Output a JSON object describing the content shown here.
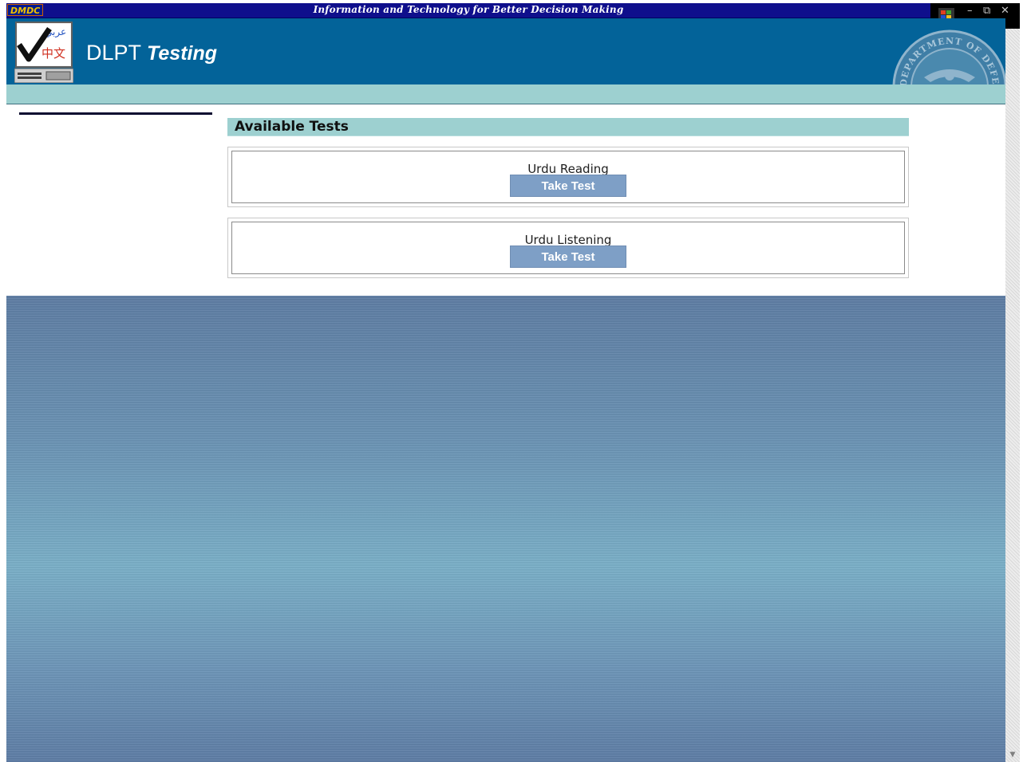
{
  "top_strip": {
    "badge": "DMDC",
    "slogan": "Information and Technology for Better Decision Making",
    "window_controls": {
      "minimize": "–",
      "restore": "⧉",
      "close": "✕"
    }
  },
  "header": {
    "logo_icon": "dlpt-checkmark-logo-icon",
    "title_main": "DLPT",
    "title_sub": "Testing",
    "seal_icon": "department-of-defense-seal-icon",
    "seal_text": "DEPARTMENT OF DEFENSE"
  },
  "main": {
    "section_title": "Available Tests",
    "tests": [
      {
        "name": "Urdu Reading",
        "button_label": "Take Test"
      },
      {
        "name": "Urdu Listening",
        "button_label": "Take Test"
      }
    ]
  },
  "colors": {
    "banner": "#0f0f8c",
    "header": "#036399",
    "accent_bar": "#9dd0d0",
    "button": "#7e9fc6"
  }
}
